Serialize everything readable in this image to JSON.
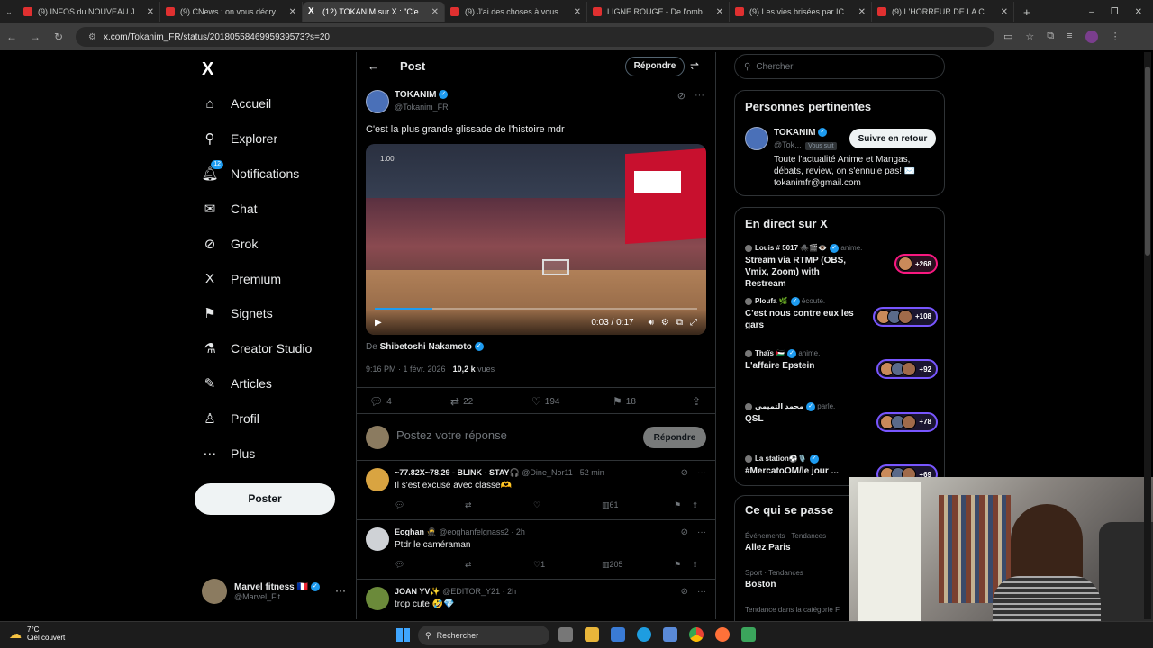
{
  "browser": {
    "tabs": [
      {
        "label": "(9) INFOS du NOUVEAU Jeu DR",
        "active": false
      },
      {
        "label": "(9) CNews : on vous décrypte la",
        "active": false
      },
      {
        "label": "(12) TOKANIM sur X : \"C'est la p",
        "active": true
      },
      {
        "label": "(9) J'ai des choses à vous dire.",
        "active": false
      },
      {
        "label": "LIGNE ROUGE - De l'ombre à la",
        "active": false
      },
      {
        "label": "(9) Les vies brisées par ICE - rep",
        "active": false
      },
      {
        "label": "(9) L'HORREUR DE LA CHIRURG",
        "active": false
      }
    ],
    "new_tab": "+",
    "url": "x.com/Tokanim_FR/status/2018055846995939573?s=20"
  },
  "leftnav": {
    "logo": "X",
    "items": [
      {
        "label": "Accueil",
        "icon": "home-icon",
        "glyph": "⌂"
      },
      {
        "label": "Explorer",
        "icon": "search-icon",
        "glyph": "⚲"
      },
      {
        "label": "Notifications",
        "icon": "bell-icon",
        "glyph": "🔔︎",
        "badge": "12"
      },
      {
        "label": "Chat",
        "icon": "mail-icon",
        "glyph": "✉"
      },
      {
        "label": "Grok",
        "icon": "grok-icon",
        "glyph": "⊘"
      },
      {
        "label": "Premium",
        "icon": "x-logo-icon",
        "glyph": "X"
      },
      {
        "label": "Signets",
        "icon": "bookmark-icon",
        "glyph": "⚑"
      },
      {
        "label": "Creator Studio",
        "icon": "flask-icon",
        "glyph": "⚗"
      },
      {
        "label": "Articles",
        "icon": "article-icon",
        "glyph": "✎"
      },
      {
        "label": "Profil",
        "icon": "user-icon",
        "glyph": "♙"
      },
      {
        "label": "Plus",
        "icon": "more-icon",
        "glyph": "⋯"
      }
    ],
    "post_label": "Poster",
    "account": {
      "name": "Marvel fitness 🇫🇷",
      "handle": "@Marvel_Fit",
      "more": "···"
    }
  },
  "main": {
    "title": "Post",
    "reply_label": "Répondre",
    "tweet": {
      "name": "TOKANIM",
      "handle": "@Tokanim_FR",
      "text": "C'est la plus grande glissade de l'histoire mdr",
      "video": {
        "speed": "1.00",
        "time": "0:03 / 0:17",
        "progress": 0.18
      },
      "from_prefix": "De",
      "from_name": "Shibetoshi Nakamoto",
      "timestamp": "9:16 PM · 1 févr. 2026 · ",
      "views": "10,2 k",
      "views_label": " vues",
      "replies": "4",
      "reposts": "22",
      "likes": "194",
      "bookmarks": "18"
    },
    "reply_box": {
      "placeholder": "Postez votre réponse",
      "button": "Répondre"
    },
    "comments": [
      {
        "name": "~77.82X~78.29 - BLINK - STAY🎧",
        "handle": "@Dine_Nor11 · 52 min",
        "text": "Il s'est excusé avec classe🫶",
        "likes": "",
        "views": "61",
        "avatar_color": "#d9a441"
      },
      {
        "name": "Eoghan 🥷",
        "handle": "@eoghanfelgnass2 · 2h",
        "text": "Ptdr le caméraman",
        "likes": "1",
        "views": "205",
        "avatar_color": "#cfd2d6"
      },
      {
        "name": "JOAN YV✨",
        "handle": "@EDITOR_Y21 · 2h",
        "text": "trop cute 🤣💎",
        "likes": "",
        "views": "",
        "avatar_color": "#6b8a3a"
      }
    ]
  },
  "right": {
    "search_placeholder": "Chercher",
    "relevant": {
      "title": "Personnes pertinentes",
      "name": "TOKANIM",
      "handle": "@Tok...",
      "follows_you": "Vous suit",
      "follow_label": "Suivre en retour",
      "bio": "Toute l'actualité Anime et Mangas, débats, review, on s'ennuie pas! ✉️ tokanimfr@gmail.com"
    },
    "live": {
      "title": "En direct sur X",
      "spaces": [
        {
          "host": "Louis # 5017 🕷️🎬👁️",
          "verb": "anime.",
          "title": "Stream via RTMP (OBS, Vmix, Zoom) with Restream",
          "count": "+268",
          "pink": true
        },
        {
          "host": "Ploufa 🌿",
          "verb": "écoute.",
          "title": "C'est nous contre eux les gars",
          "count": "+108",
          "pink": false
        },
        {
          "host": "Thaïs 🇵🇸",
          "verb": "anime.",
          "title": "L'affaire Epstein",
          "count": "+92",
          "pink": false
        },
        {
          "host": "محمد التميمي",
          "verb": "parle.",
          "title": "QSL",
          "count": "+78",
          "pink": false
        },
        {
          "host": "La station⚽🎙️",
          "verb": "",
          "title": "#MercatoOM/le jour ...",
          "count": "+69",
          "pink": false
        }
      ]
    },
    "happening": {
      "title": "Ce qui se passe",
      "trends": [
        {
          "context": "Événements · Tendances",
          "name": "Allez Paris"
        },
        {
          "context": "Sport · Tendances",
          "name": "Boston"
        },
        {
          "context": "Tendance dans la catégorie F",
          "name": ""
        }
      ]
    }
  },
  "taskbar": {
    "temp": "7°C",
    "weather": "Ciel couvert",
    "search_placeholder": "Rechercher"
  }
}
